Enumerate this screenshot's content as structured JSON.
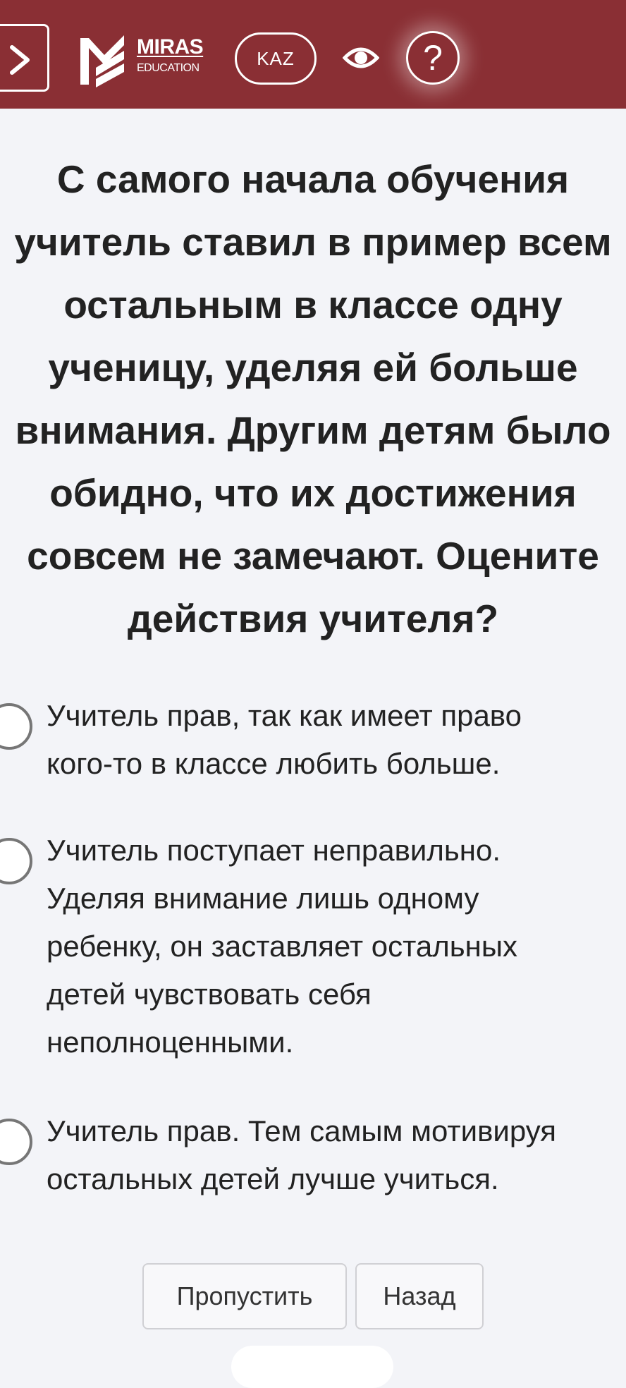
{
  "header": {
    "logo_title": "MIRAS",
    "logo_subtitle": "EDUCATION",
    "language_label": "KAZ",
    "help_label": "?",
    "bg_color": "#8a2f34"
  },
  "question": {
    "lines": [
      "С самого начала обучения",
      "учитель ставил в пример всем",
      "остальным в классе одну",
      "ученицу, уделяя ей больше",
      "внимания. Другим детям было",
      "обидно, что их достижения",
      "совсем не замечают. Оцените",
      "действия учителя?"
    ]
  },
  "options": [
    {
      "lines": [
        "Учитель прав, так как имеет право",
        "кого-то в классе любить больше."
      ]
    },
    {
      "lines": [
        "Учитель поступает неправильно.",
        "Уделяя внимание лишь одному",
        "ребенку, он заставляет остальных",
        "детей чувствовать себя",
        "неполноценными."
      ]
    },
    {
      "lines": [
        "Учитель прав. Тем самым мотивируя",
        "остальных детей лучше учиться."
      ]
    }
  ],
  "buttons": {
    "skip_label": "Пропустить",
    "back_label": "Назад"
  },
  "icons": {
    "menu": "chevron-right-icon",
    "eye": "eye-icon"
  }
}
